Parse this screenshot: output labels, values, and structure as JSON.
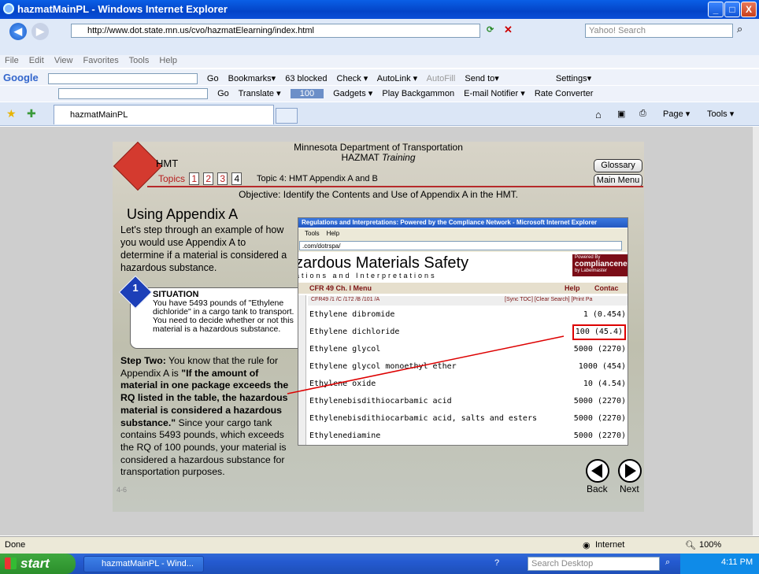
{
  "window": {
    "title": "hazmatMainPL - Windows Internet Explorer",
    "min": "_",
    "max": "□",
    "close": "X"
  },
  "address": {
    "url": "http://www.dot.state.mn.us/cvo/hazmatElearning/index.html",
    "search_placeholder": "Yahoo! Search"
  },
  "menubar": [
    "File",
    "Edit",
    "View",
    "Favorites",
    "Tools",
    "Help"
  ],
  "google_toolbar": {
    "label": "Google",
    "items": [
      "Go",
      "Bookmarks▾",
      "63 blocked",
      "Check ▾",
      "AutoLink ▾",
      "AutoFill",
      "Send to▾",
      "Settings▾"
    ]
  },
  "second_toolbar": {
    "items": [
      "Go",
      "Translate ▾",
      "100",
      "Gadgets ▾",
      "Play Backgammon",
      "E-mail Notifier ▾",
      "Rate Converter"
    ]
  },
  "tab": {
    "label": "hazmatMainPL"
  },
  "command_bar": {
    "items": [
      "Page ▾",
      "Tools ▾"
    ]
  },
  "lesson": {
    "org_line1": "Minnesota Department of Transportation",
    "org_line2_a": "HAZMAT ",
    "org_line2_b": "Training",
    "hmt": "HMT",
    "topics_label": "Topics",
    "topic_numbers": [
      "1",
      "2",
      "3",
      "4"
    ],
    "topic_name": "Topic 4: HMT Appendix A and B",
    "glossary": "Glossary",
    "main_menu": "Main Menu",
    "objective": "Objective: Identify the Contents and Use of Appendix A in the HMT.",
    "heading": "Using Appendix A",
    "intro": "Let's step through an example of how you would use Appendix A to determine if a material is considered a hazardous substance.",
    "badge": "1",
    "situation_title": "SITUATION",
    "situation_text": "You have 5493 pounds of \"Ethylene dichloride\" in a cargo tank to transport. You need to decide whether or not this material is a hazardous substance.",
    "step_label": "Step Two:",
    "step_text1": " You know that the rule for Appendix A is ",
    "step_bold": "\"If the amount of material in one package exceeds the RQ listed in the table, the hazardous material is considered a hazardous substance.\"",
    "step_text2": " Since your cargo tank contains 5493 pounds, which exceeds the RQ of 100 pounds, your material is considered a hazardous substance for transportation purposes.",
    "page_code": "4-6",
    "back": "Back",
    "next": "Next"
  },
  "embedded": {
    "title": "Regulations and Interpretations: Powered by the Compliance Network - Microsoft Internet Explorer",
    "menu": [
      "Tools",
      "Help"
    ],
    "address": ".com/dotrspa/",
    "banner_title": "zardous Materials Safety",
    "banner_sub": "ations and Interpretations",
    "cn_small": "Powered By",
    "cn_big": "compliancenetwor",
    "cn_tiny": "by Labelmaster",
    "nav_left": "CFR 49 Ch. I Menu",
    "nav_help": "Help",
    "nav_contact": "Contac",
    "crumb": "CFR49 /1 /C /172 /B /101 /A",
    "crumb_right": "[Sync TOC]  [Clear Search]  [Print Pa",
    "rows": [
      {
        "name": "Ethylene dibromide",
        "rq": "1 (0.454)"
      },
      {
        "name": "Ethylene dichloride",
        "rq": "100 (45.4)"
      },
      {
        "name": "Ethylene glycol",
        "rq": "5000 (2270)"
      },
      {
        "name": "Ethylene glycol monoethyl ether",
        "rq": "1000 (454)"
      },
      {
        "name": "Ethylene oxide",
        "rq": "10 (4.54)"
      },
      {
        "name": "Ethylenebisdithiocarbamic acid",
        "rq": "5000 (2270)"
      },
      {
        "name": "Ethylenebisdithiocarbamic acid, salts and esters",
        "rq": "5000 (2270)"
      },
      {
        "name": "Ethylenediamine",
        "rq": "5000 (2270)"
      }
    ]
  },
  "status": {
    "text": "Done",
    "zone": "Internet",
    "zoom": "100%"
  },
  "taskbar": {
    "start": "start",
    "item": "hazmatMainPL - Wind...",
    "search_placeholder": "Search Desktop",
    "time": "4:11 PM"
  },
  "colors": {
    "titlebar": "#0a5fe6",
    "diamond": "#d43a2f",
    "highlight": "#dd0000",
    "taskbar": "#245ad0"
  }
}
